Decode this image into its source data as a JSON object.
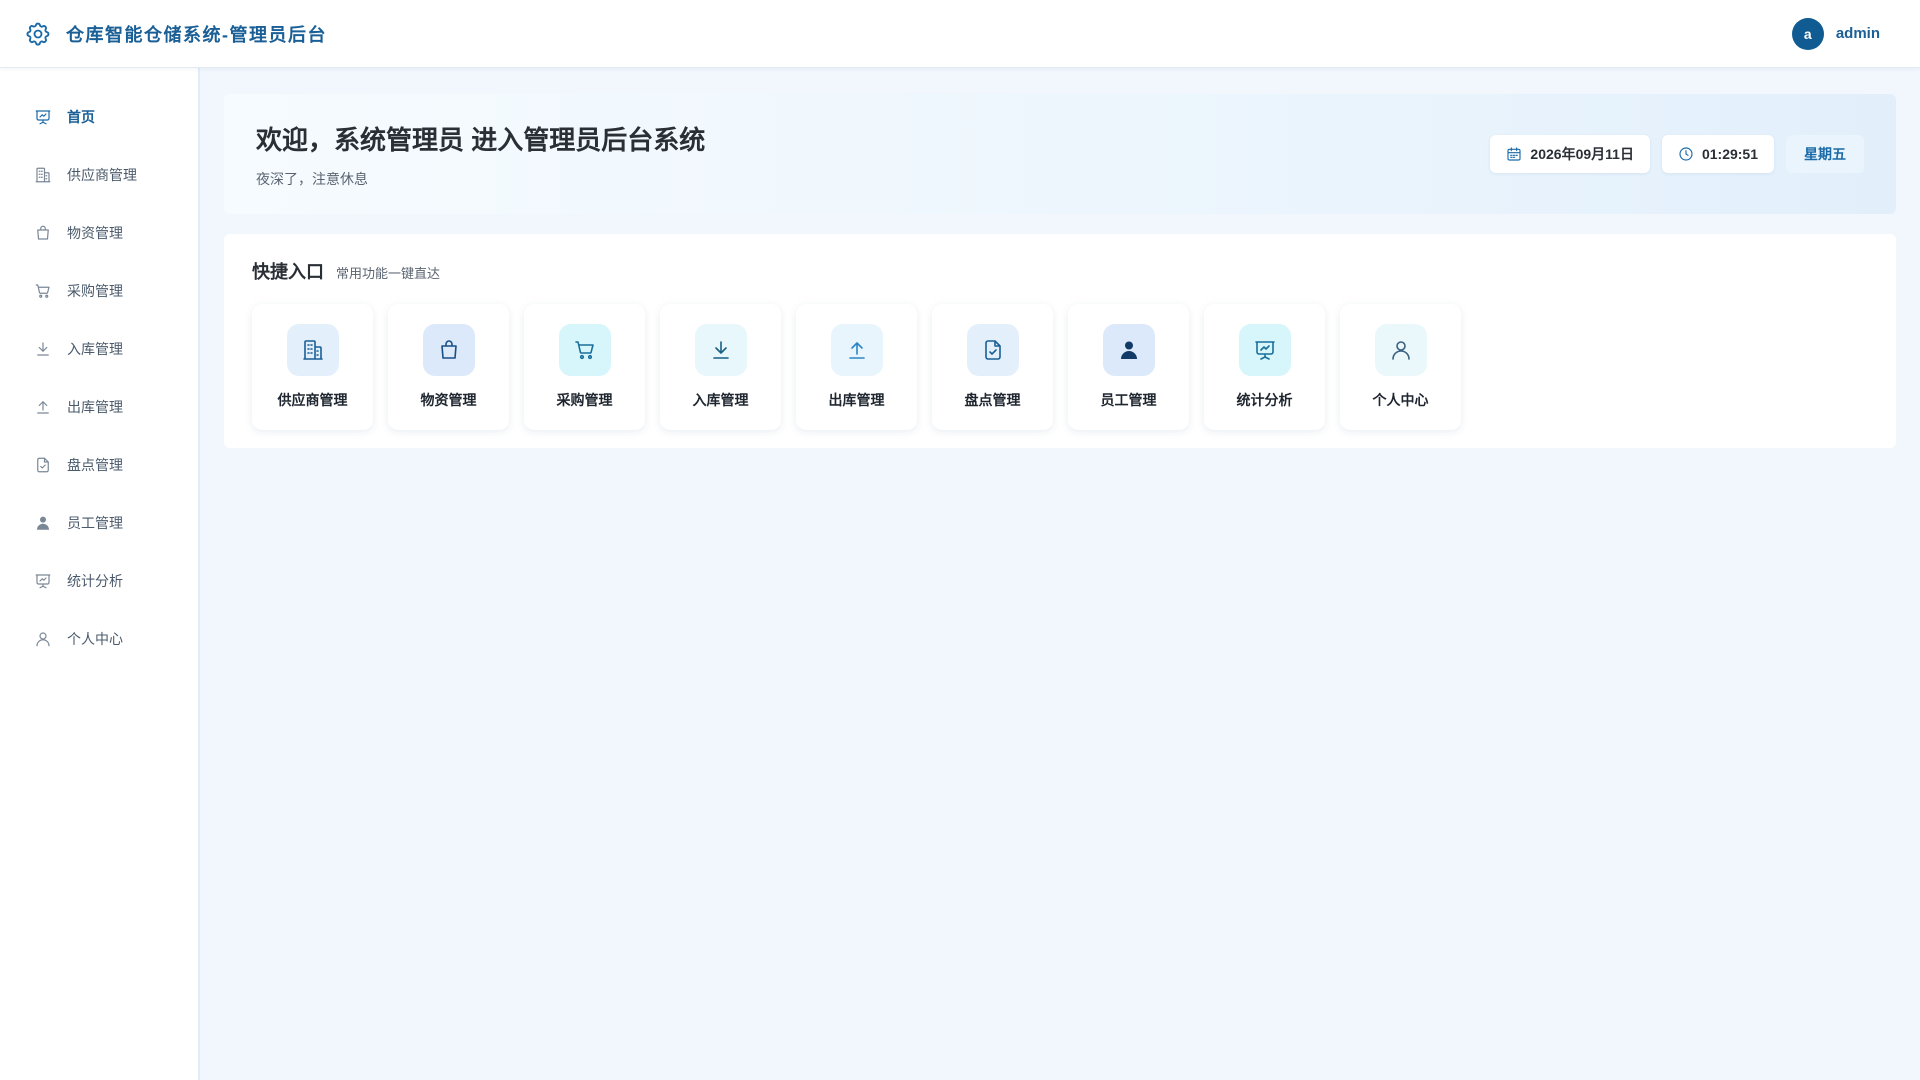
{
  "header": {
    "title": "仓库智能仓储系统-管理员后台",
    "logo_icon": "gear-icon",
    "user": {
      "avatar_letter": "a",
      "name": "admin"
    }
  },
  "sidebar": {
    "items": [
      {
        "label": "首页",
        "icon": "presentation-chart-icon",
        "active": true
      },
      {
        "label": "供应商管理",
        "icon": "building-icon"
      },
      {
        "label": "物资管理",
        "icon": "shopping-bag-icon"
      },
      {
        "label": "采购管理",
        "icon": "cart-icon"
      },
      {
        "label": "入库管理",
        "icon": "download-icon"
      },
      {
        "label": "出库管理",
        "icon": "upload-icon"
      },
      {
        "label": "盘点管理",
        "icon": "document-check-icon"
      },
      {
        "label": "员工管理",
        "icon": "user-solid-icon"
      },
      {
        "label": "统计分析",
        "icon": "presentation-chart-icon"
      },
      {
        "label": "个人中心",
        "icon": "user-outline-icon"
      }
    ]
  },
  "welcome": {
    "title": "欢迎，系统管理员 进入管理员后台系统",
    "subtitle": "夜深了，注意休息",
    "date": "2026年09月11日",
    "time": "01:29:51",
    "weekday": "星期五"
  },
  "quick": {
    "title": "快捷入口",
    "subtitle": "常用功能一键直达",
    "cards": [
      {
        "label": "供应商管理",
        "icon": "building-icon",
        "bg": "#e3f0fb",
        "color": "#1a5f96"
      },
      {
        "label": "物资管理",
        "icon": "shopping-bag-icon",
        "bg": "#dce9fa",
        "color": "#1a4f86"
      },
      {
        "label": "采购管理",
        "icon": "cart-icon",
        "bg": "#d6f6fb",
        "color": "#1a6f9a"
      },
      {
        "label": "入库管理",
        "icon": "download-icon",
        "bg": "#e7f7fc",
        "color": "#1a5f86"
      },
      {
        "label": "出库管理",
        "icon": "upload-icon",
        "bg": "#e9f5fc",
        "color": "#2a86c8"
      },
      {
        "label": "盘点管理",
        "icon": "document-check-icon",
        "bg": "#e3f0fb",
        "color": "#1a5f96"
      },
      {
        "label": "员工管理",
        "icon": "user-solid-icon",
        "bg": "#dce9fa",
        "color": "#123a66"
      },
      {
        "label": "统计分析",
        "icon": "presentation-chart-icon",
        "bg": "#d6f6fb",
        "color": "#1a6f9a"
      },
      {
        "label": "个人中心",
        "icon": "user-outline-icon",
        "bg": "#eaf8fc",
        "color": "#3a5f80"
      }
    ]
  },
  "colors": {
    "brand": "#1a5f96",
    "avatar_bg": "#0f5b92",
    "page_bg": "#f1f7fd"
  }
}
